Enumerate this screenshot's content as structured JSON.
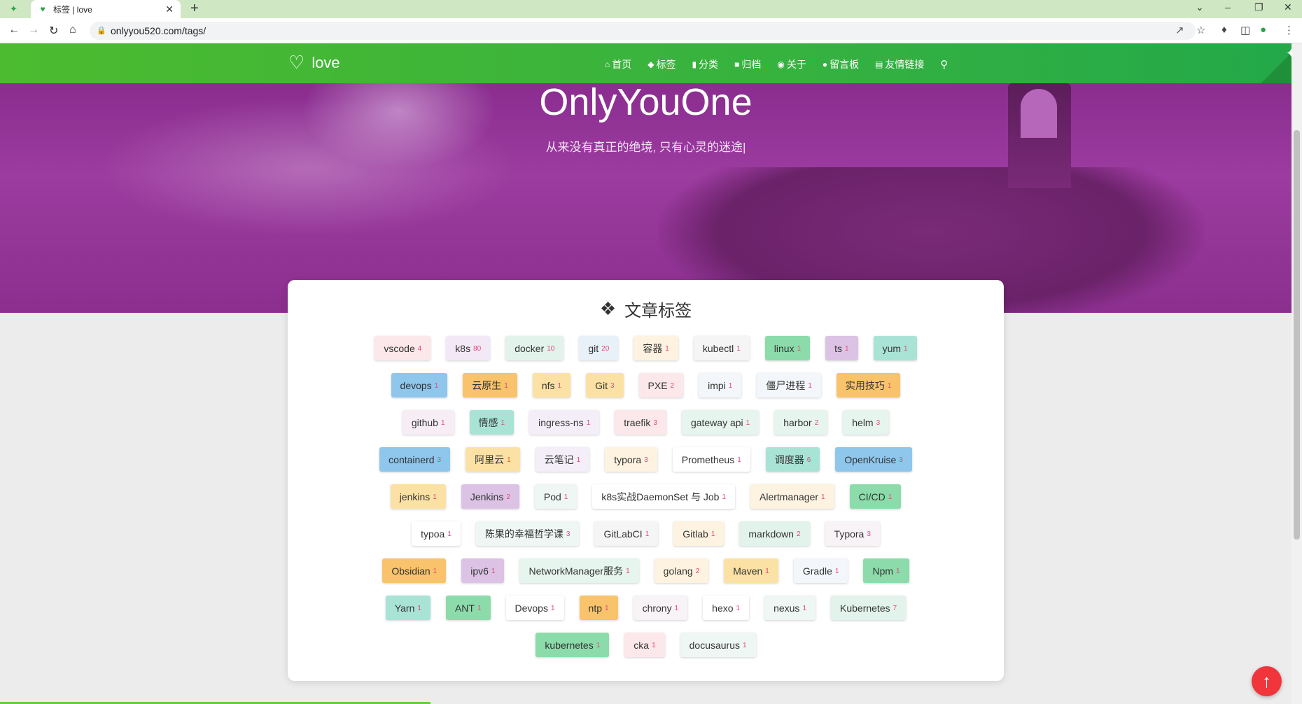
{
  "browser": {
    "tab_title": "标签 | love",
    "url": "onlyyou520.com/tags/"
  },
  "site": {
    "logo_text": "love",
    "nav": [
      {
        "label": "首页",
        "icon": "home-icon"
      },
      {
        "label": "标签",
        "icon": "tag-icon"
      },
      {
        "label": "分类",
        "icon": "bookmark-icon"
      },
      {
        "label": "归档",
        "icon": "archive-icon"
      },
      {
        "label": "关于",
        "icon": "user-circle-icon"
      },
      {
        "label": "留言板",
        "icon": "comments-icon"
      },
      {
        "label": "友情链接",
        "icon": "address-book-icon"
      }
    ]
  },
  "hero": {
    "title": "OnlyYouOne",
    "subtitle": "从来没有真正的绝境, 只有心灵的迷途|"
  },
  "card": {
    "title": "文章标签"
  },
  "tags": [
    [
      {
        "name": "vscode",
        "count": "4",
        "color": "#fce8ea"
      },
      {
        "name": "k8s",
        "count": "80",
        "color": "#f3e8f5"
      },
      {
        "name": "docker",
        "count": "10",
        "color": "#e2f3ec"
      },
      {
        "name": "git",
        "count": "20",
        "color": "#e8f1f8"
      },
      {
        "name": "容器",
        "count": "1",
        "color": "#fdf3e0"
      },
      {
        "name": "kubectl",
        "count": "1",
        "color": "#f5f5f5"
      },
      {
        "name": "linux",
        "count": "1",
        "color": "#8bdcaa"
      },
      {
        "name": "ts",
        "count": "1",
        "color": "#dcc3e6"
      },
      {
        "name": "yum",
        "count": "1",
        "color": "#a9e3d6"
      }
    ],
    [
      {
        "name": "devops",
        "count": "1",
        "color": "#8ec6ec"
      },
      {
        "name": "云原生",
        "count": "1",
        "color": "#f8c36a"
      },
      {
        "name": "nfs",
        "count": "1",
        "color": "#fbe2a4"
      },
      {
        "name": "Git",
        "count": "3",
        "color": "#fbe2a4"
      },
      {
        "name": "PXE",
        "count": "2",
        "color": "#fce8ea"
      },
      {
        "name": "impi",
        "count": "1",
        "color": "#f3f6fa"
      },
      {
        "name": "僵尸进程",
        "count": "1",
        "color": "#f3f6fa"
      },
      {
        "name": "实用技巧",
        "count": "1",
        "color": "#f8c36a"
      }
    ],
    [
      {
        "name": "github",
        "count": "1",
        "color": "#f7eef5"
      },
      {
        "name": "情感",
        "count": "1",
        "color": "#a9e3d6"
      },
      {
        "name": "ingress-ns",
        "count": "1",
        "color": "#f3eef7"
      },
      {
        "name": "traefik",
        "count": "3",
        "color": "#fce8ea"
      },
      {
        "name": "gateway api",
        "count": "1",
        "color": "#e6f5ee"
      },
      {
        "name": "harbor",
        "count": "2",
        "color": "#e6f5ee"
      },
      {
        "name": "helm",
        "count": "3",
        "color": "#e6f5ee"
      }
    ],
    [
      {
        "name": "containerd",
        "count": "3",
        "color": "#8ec6ec"
      },
      {
        "name": "阿里云",
        "count": "1",
        "color": "#fbe2a4"
      },
      {
        "name": "云笔记",
        "count": "1",
        "color": "#f3eef7"
      },
      {
        "name": "typora",
        "count": "3",
        "color": "#fdf3e0"
      },
      {
        "name": "Prometheus",
        "count": "1",
        "color": "#ffffff"
      },
      {
        "name": "调度器",
        "count": "6",
        "color": "#a9e3d6"
      },
      {
        "name": "OpenKruise",
        "count": "3",
        "color": "#8ec6ec"
      }
    ],
    [
      {
        "name": "jenkins",
        "count": "1",
        "color": "#fbe2a4"
      },
      {
        "name": "Jenkins",
        "count": "2",
        "color": "#dcc3e6"
      },
      {
        "name": "Pod",
        "count": "1",
        "color": "#eef7f4"
      },
      {
        "name": "k8s实战DaemonSet 与 Job",
        "count": "1",
        "color": "#ffffff"
      },
      {
        "name": "Alertmanager",
        "count": "1",
        "color": "#fdf3e0"
      },
      {
        "name": "CI/CD",
        "count": "1",
        "color": "#8bdcaa"
      }
    ],
    [
      {
        "name": "typoa",
        "count": "1",
        "color": "#ffffff"
      },
      {
        "name": "陈果的幸福哲学课",
        "count": "3",
        "color": "#eef7f4"
      },
      {
        "name": "GitLabCI",
        "count": "1",
        "color": "#f5f5f5"
      },
      {
        "name": "Gitlab",
        "count": "1",
        "color": "#fdf3e0"
      },
      {
        "name": "markdown",
        "count": "2",
        "color": "#e2f3ec"
      },
      {
        "name": "Typora",
        "count": "3",
        "color": "#f7f3f7"
      }
    ],
    [
      {
        "name": "Obsidian",
        "count": "1",
        "color": "#f8c36a"
      },
      {
        "name": "ipv6",
        "count": "1",
        "color": "#dcc3e6"
      },
      {
        "name": "NetworkManager服务",
        "count": "1",
        "color": "#e6f5ee"
      },
      {
        "name": "golang",
        "count": "2",
        "color": "#fdf3e0"
      },
      {
        "name": "Maven",
        "count": "1",
        "color": "#fbe2a4"
      },
      {
        "name": "Gradle",
        "count": "1",
        "color": "#f3f6fa"
      },
      {
        "name": "Npm",
        "count": "1",
        "color": "#8bdcaa"
      }
    ],
    [
      {
        "name": "Yarn",
        "count": "1",
        "color": "#a9e3d6"
      },
      {
        "name": "ANT",
        "count": "1",
        "color": "#8bdcaa"
      },
      {
        "name": "Devops",
        "count": "1",
        "color": "#ffffff"
      },
      {
        "name": "ntp",
        "count": "1",
        "color": "#f8c36a"
      },
      {
        "name": "chrony",
        "count": "1",
        "color": "#f7f3f7"
      },
      {
        "name": "hexo",
        "count": "1",
        "color": "#ffffff"
      },
      {
        "name": "nexus",
        "count": "1",
        "color": "#eef7f4"
      },
      {
        "name": "Kubernetes",
        "count": "7",
        "color": "#e2f3ec"
      }
    ],
    [
      {
        "name": "kubernetes",
        "count": "1",
        "color": "#8bdcaa"
      },
      {
        "name": "cka",
        "count": "1",
        "color": "#fce8ea"
      },
      {
        "name": "docusaurus",
        "count": "1",
        "color": "#eef7f4"
      }
    ]
  ]
}
